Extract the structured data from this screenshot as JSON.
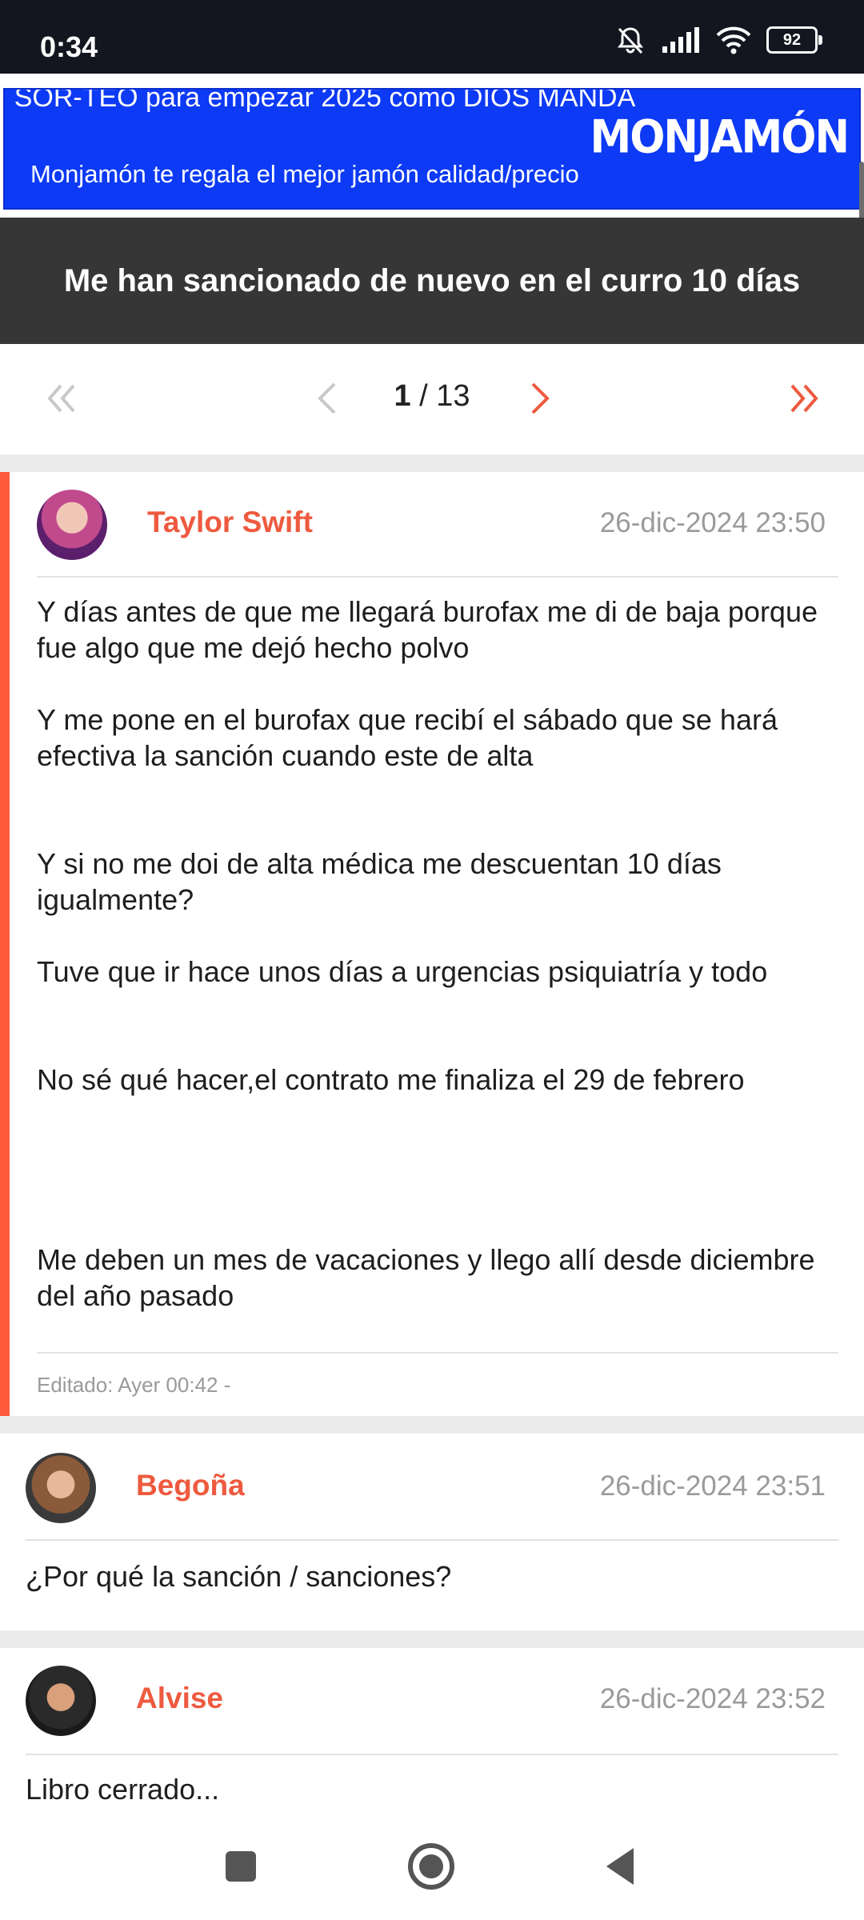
{
  "status": {
    "time": "0:34",
    "battery": "92"
  },
  "ad": {
    "title": "SOR-TEO para empezar 2025 como DIOS MANDA",
    "subtitle": "Monjamón te regala el mejor jamón calidad/precio",
    "logo": "MONJAMÓN"
  },
  "thread": {
    "title": "Me han sancionado de nuevo en el curro 10 días"
  },
  "pagination": {
    "current": "1",
    "separator": "/",
    "total": "13"
  },
  "posts": [
    {
      "author": "Taylor Swift",
      "date": "26-dic-2024 23:50",
      "paragraphs": [
        "Y días antes de que me llegará burofax me di de baja porque fue algo que me dejó hecho polvo",
        "Y me pone en el burofax que recibí el sábado que se hará efectiva la sanción cuando este de alta",
        "Y si no me doi de alta médica me descuentan 10 días igualmente?",
        "Tuve que ir hace unos días a urgencias psiquiatría y todo",
        "No sé qué hacer,el contrato me finaliza el 29 de febrero",
        "Me deben un mes de vacaciones y llego allí desde diciembre del año pasado"
      ],
      "edited": "Editado: Ayer 00:42 -"
    },
    {
      "author": "Begoña",
      "date": "26-dic-2024 23:51",
      "paragraphs": [
        "¿Por qué la sanción / sanciones?"
      ]
    },
    {
      "author": "Alvise",
      "date": "26-dic-2024 23:52",
      "paragraphs": [
        "Libro cerrado..."
      ]
    }
  ],
  "colors": {
    "accent": "#ee5a3f",
    "ad_bg": "#0d3af5",
    "title_bg": "#363636"
  }
}
